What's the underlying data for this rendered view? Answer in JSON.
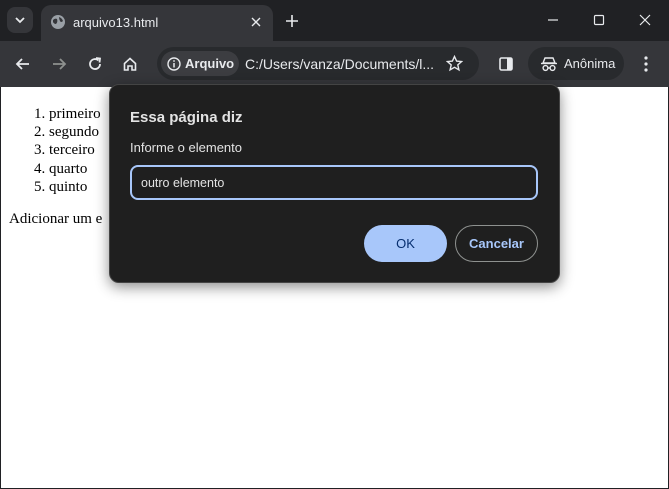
{
  "tab": {
    "title": "arquivo13.html"
  },
  "toolbar": {
    "chip_label": "Arquivo",
    "url": "C:/Users/vanza/Documents/l...",
    "incognito_label": "Anônima"
  },
  "page": {
    "list_items": [
      "primeiro",
      "segundo",
      "terceiro",
      "quarto",
      "quinto"
    ],
    "paragraph": "Adicionar um e"
  },
  "dialog": {
    "title": "Essa página diz",
    "message": "Informe o elemento",
    "input_value": "outro elemento",
    "ok_label": "OK",
    "cancel_label": "Cancelar"
  },
  "colors": {
    "dialog_bg": "#1f1f1f",
    "accent": "#a8c7fa",
    "chrome_dark": "#202124",
    "toolbar": "#35363a"
  }
}
